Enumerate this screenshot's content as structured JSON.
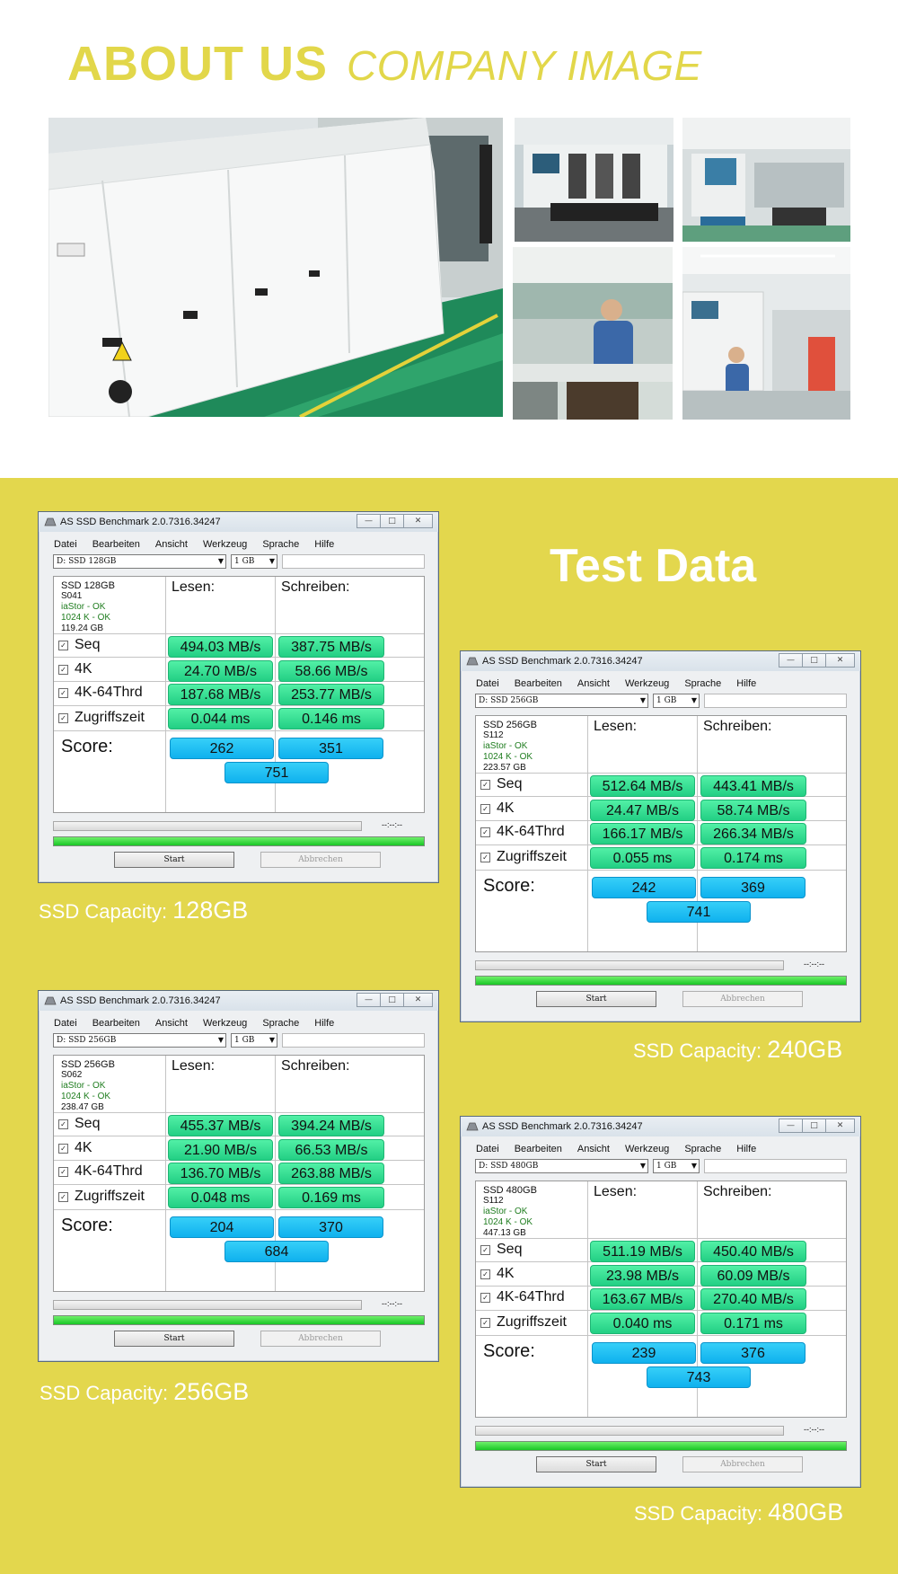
{
  "header": {
    "title": "ABOUT US",
    "subtitle": "COMPANY IMAGE"
  },
  "test_title": "Test Data",
  "benchmarks": [
    {
      "window_title": "AS SSD Benchmark 2.0.7316.34247",
      "menu": [
        "Datei",
        "Bearbeiten",
        "Ansicht",
        "Werkzeug",
        "Sprache",
        "Hilfe"
      ],
      "drive_select": "D: SSD 128GB",
      "size_select": "1 GB",
      "drive_name": "SSD 128GB",
      "model": "S041",
      "driver_status": "iaStor - OK",
      "align_status": "1024 K - OK",
      "size": "119.24 GB",
      "col_read": "Lesen:",
      "col_write": "Schreiben:",
      "rows": [
        {
          "label": "Seq",
          "read": "494.03 MB/s",
          "write": "387.75 MB/s"
        },
        {
          "label": "4K",
          "read": "24.70 MB/s",
          "write": "58.66 MB/s"
        },
        {
          "label": "4K-64Thrd",
          "read": "187.68 MB/s",
          "write": "253.77 MB/s"
        },
        {
          "label": "Zugriffszeit",
          "read": "0.044 ms",
          "write": "0.146 ms"
        }
      ],
      "score_label": "Score:",
      "score_read": "262",
      "score_write": "351",
      "score_total": "751",
      "time": "--:--:--",
      "start": "Start",
      "abort": "Abbrechen",
      "cap_label": "SSD Capacity:",
      "cap_value": "128GB"
    },
    {
      "window_title": "AS SSD Benchmark 2.0.7316.34247",
      "menu": [
        "Datei",
        "Bearbeiten",
        "Ansicht",
        "Werkzeug",
        "Sprache",
        "Hilfe"
      ],
      "drive_select": "D: SSD 256GB",
      "size_select": "1 GB",
      "drive_name": "SSD 256GB",
      "model": "S112",
      "driver_status": "iaStor - OK",
      "align_status": "1024 K - OK",
      "size": "223.57 GB",
      "col_read": "Lesen:",
      "col_write": "Schreiben:",
      "rows": [
        {
          "label": "Seq",
          "read": "512.64 MB/s",
          "write": "443.41 MB/s"
        },
        {
          "label": "4K",
          "read": "24.47 MB/s",
          "write": "58.74 MB/s"
        },
        {
          "label": "4K-64Thrd",
          "read": "166.17 MB/s",
          "write": "266.34 MB/s"
        },
        {
          "label": "Zugriffszeit",
          "read": "0.055 ms",
          "write": "0.174 ms"
        }
      ],
      "score_label": "Score:",
      "score_read": "242",
      "score_write": "369",
      "score_total": "741",
      "time": "--:--:--",
      "start": "Start",
      "abort": "Abbrechen",
      "cap_label": "SSD Capacity:",
      "cap_value": "240GB"
    },
    {
      "window_title": "AS SSD Benchmark 2.0.7316.34247",
      "menu": [
        "Datei",
        "Bearbeiten",
        "Ansicht",
        "Werkzeug",
        "Sprache",
        "Hilfe"
      ],
      "drive_select": "D: SSD 256GB",
      "size_select": "1 GB",
      "drive_name": "SSD 256GB",
      "model": "S062",
      "driver_status": "iaStor - OK",
      "align_status": "1024 K - OK",
      "size": "238.47 GB",
      "col_read": "Lesen:",
      "col_write": "Schreiben:",
      "rows": [
        {
          "label": "Seq",
          "read": "455.37 MB/s",
          "write": "394.24 MB/s"
        },
        {
          "label": "4K",
          "read": "21.90 MB/s",
          "write": "66.53 MB/s"
        },
        {
          "label": "4K-64Thrd",
          "read": "136.70 MB/s",
          "write": "263.88 MB/s"
        },
        {
          "label": "Zugriffszeit",
          "read": "0.048 ms",
          "write": "0.169 ms"
        }
      ],
      "score_label": "Score:",
      "score_read": "204",
      "score_write": "370",
      "score_total": "684",
      "time": "--:--:--",
      "start": "Start",
      "abort": "Abbrechen",
      "cap_label": "SSD Capacity:",
      "cap_value": "256GB"
    },
    {
      "window_title": "AS SSD Benchmark 2.0.7316.34247",
      "menu": [
        "Datei",
        "Bearbeiten",
        "Ansicht",
        "Werkzeug",
        "Sprache",
        "Hilfe"
      ],
      "drive_select": "D: SSD 480GB",
      "size_select": "1 GB",
      "drive_name": "SSD 480GB",
      "model": "S112",
      "driver_status": "iaStor - OK",
      "align_status": "1024 K - OK",
      "size": "447.13 GB",
      "col_read": "Lesen:",
      "col_write": "Schreiben:",
      "rows": [
        {
          "label": "Seq",
          "read": "511.19 MB/s",
          "write": "450.40 MB/s"
        },
        {
          "label": "4K",
          "read": "23.98 MB/s",
          "write": "60.09 MB/s"
        },
        {
          "label": "4K-64Thrd",
          "read": "163.67 MB/s",
          "write": "270.40 MB/s"
        },
        {
          "label": "Zugriffszeit",
          "read": "0.040 ms",
          "write": "0.171 ms"
        }
      ],
      "score_label": "Score:",
      "score_read": "239",
      "score_write": "376",
      "score_total": "743",
      "time": "--:--:--",
      "start": "Start",
      "abort": "Abbrechen",
      "cap_label": "SSD Capacity:",
      "cap_value": "480GB"
    }
  ]
}
